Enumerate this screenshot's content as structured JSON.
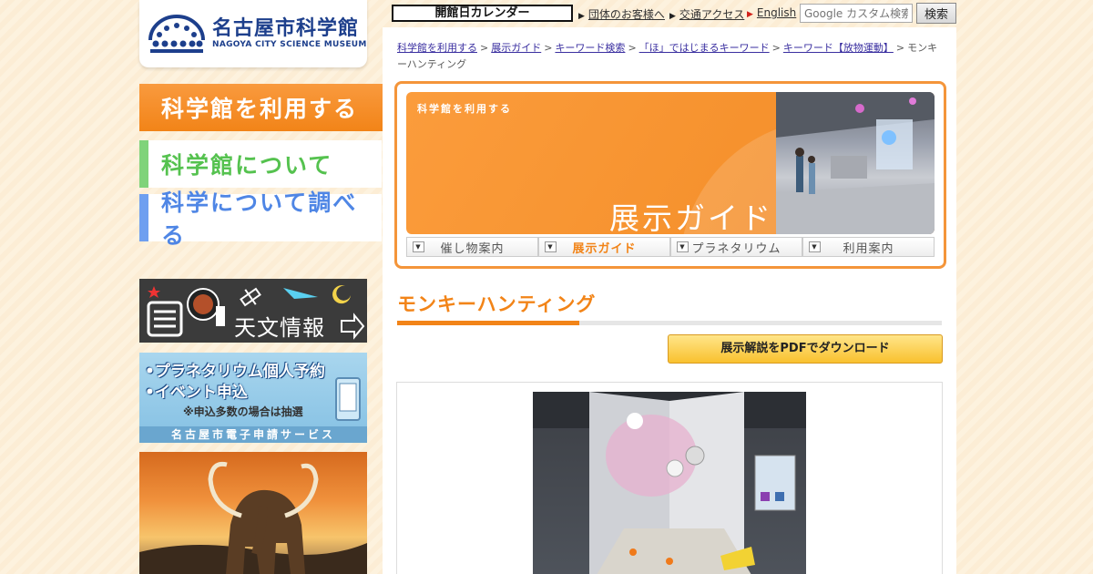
{
  "header": {
    "logo_jp": "名古屋市科学館",
    "logo_en": "NAGOYA CITY SCIENCE MUSEUM",
    "calendar_label": "開館日カレンダー",
    "links": {
      "group": "団体のお客様へ",
      "access": "交通アクセス",
      "english": "English"
    },
    "search": {
      "placeholder": "Google カスタム検索",
      "button_label": "検索"
    }
  },
  "sidebar": {
    "nav": [
      "科学館を利用する",
      "科学館について",
      "科学について調べる"
    ],
    "banners": {
      "astro_label": "天文情報",
      "reserve_line1": "•プラネタリウム個人予約",
      "reserve_line2": "•イベント申込",
      "reserve_note": "※申込多数の場合は抽選",
      "reserve_service": "名古屋市電子申請サービス"
    }
  },
  "breadcrumb": {
    "items": [
      "科学館を利用する",
      "展示ガイド",
      "キーワード検索",
      "「ほ」ではじまるキーワード",
      "キーワード【放物運動】"
    ],
    "current": "モンキーハンティング",
    "separator": ">"
  },
  "hero": {
    "small_label": "科学館を利用する",
    "big_label": "展示ガイド"
  },
  "subtabs": [
    {
      "label": "催し物案内",
      "active": false
    },
    {
      "label": "展示ガイド",
      "active": true
    },
    {
      "label": "プラネタリウム",
      "active": false
    },
    {
      "label": "利用案内",
      "active": false
    }
  ],
  "page": {
    "title": "モンキーハンティング",
    "pdf_button": "展示解説をPDFでダウンロード"
  },
  "colors": {
    "accent_orange": "#f28418",
    "green": "#55c24f",
    "blue": "#4f86e5",
    "logo_blue": "#1d3f8c"
  }
}
